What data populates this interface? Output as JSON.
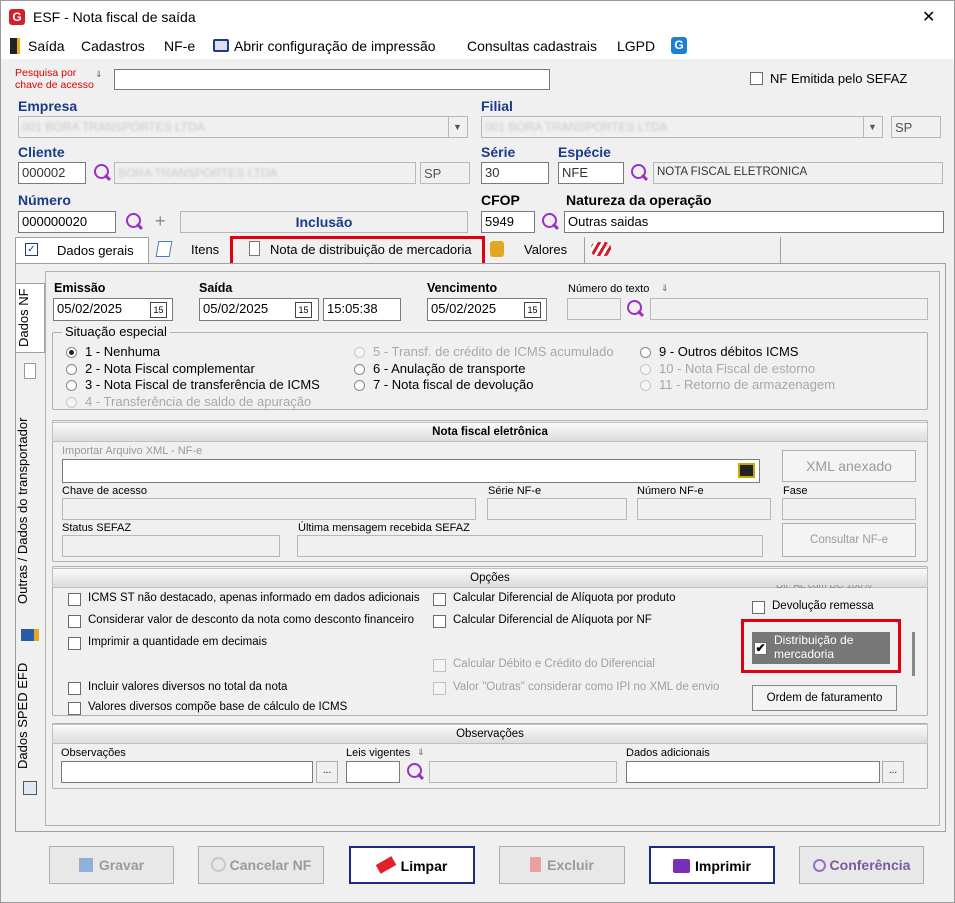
{
  "window": {
    "title": "ESF - Nota fiscal de saída",
    "close": "✕"
  },
  "menu": [
    "Saída",
    "Cadastros",
    "NF-e",
    "Abrir configuração de impressão",
    "Consultas cadastrais",
    "LGPD"
  ],
  "search": {
    "label": "Pesquisa por chave de acesso",
    "value": "",
    "nf_emitida_label": "NF Emitida pelo SEFAZ"
  },
  "empresa": {
    "label": "Empresa",
    "value": "001 BORA TRANSPORTES LTDA"
  },
  "filial": {
    "label": "Filial",
    "value": "001 BORA TRANSPORTES LTDA",
    "uf": "SP"
  },
  "cliente": {
    "label": "Cliente",
    "code": "000002",
    "name": "BORA TRANSPORTES LTDA",
    "uf": "SP"
  },
  "serie": {
    "label": "Série",
    "value": "30"
  },
  "especie": {
    "label": "Espécie",
    "code": "NFE",
    "desc": "NOTA FISCAL ELETRONICA"
  },
  "numero": {
    "label": "Número",
    "value": "000000020",
    "status": "Inclusão"
  },
  "cfop": {
    "label": "CFOP",
    "value": "5949"
  },
  "natureza": {
    "label": "Natureza da operação",
    "value": "Outras saidas"
  },
  "tabs": [
    "Dados gerais",
    "Itens",
    "Nota de distribuição de mercadoria",
    "Valores"
  ],
  "side_tabs": [
    "Dados NF",
    "Outras / Dados do transportador",
    "Dados SPED EFD"
  ],
  "dates": {
    "emissao_label": "Emissão",
    "emissao": "05/02/2025",
    "saida_label": "Saída",
    "saida": "05/02/2025",
    "saida_hora": "15:05:38",
    "venc_label": "Vencimento",
    "venc": "05/02/2025",
    "num_texto_label": "Número do texto",
    "cal_icon": "15"
  },
  "situacao": {
    "title": "Situação especial",
    "options": [
      {
        "text": "1 - Nenhuma",
        "enabled": true,
        "selected": true
      },
      {
        "text": "2 - Nota Fiscal complementar",
        "enabled": true,
        "selected": false
      },
      {
        "text": "3 - Nota Fiscal de transferência de ICMS",
        "enabled": true,
        "selected": false
      },
      {
        "text": "4 - Transferência de saldo de apuração",
        "enabled": false,
        "selected": false
      },
      {
        "text": "5 - Transf. de crédito de ICMS acumulado",
        "enabled": false,
        "selected": false
      },
      {
        "text": "6 - Anulação de transporte",
        "enabled": true,
        "selected": false
      },
      {
        "text": "7 - Nota fiscal de devolução",
        "enabled": true,
        "selected": false
      },
      {
        "text": "9 - Outros débitos ICMS",
        "enabled": true,
        "selected": false
      },
      {
        "text": "10 - Nota Fiscal de estorno",
        "enabled": false,
        "selected": false
      },
      {
        "text": "11 - Retorno de armazenagem",
        "enabled": false,
        "selected": false
      }
    ]
  },
  "nfe": {
    "title": "Nota fiscal eletrônica",
    "import_label": "Importar Arquivo XML - NF-e",
    "xml_btn": "XML anexado",
    "chave_label": "Chave de acesso",
    "serie_label": "Série NF-e",
    "numero_label": "Número NF-e",
    "fase_label": "Fase",
    "status_label": "Status SEFAZ",
    "msg_label": "Última mensagem recebida SEFAZ",
    "consultar_btn": "Consultar NF-e"
  },
  "opcoes": {
    "title": "Opções",
    "items": [
      {
        "text": "ICMS ST não destacado, apenas informado em dados adicionais",
        "enabled": true
      },
      {
        "text": "Considerar valor de desconto da nota como desconto financeiro",
        "enabled": true
      },
      {
        "text": "Imprimir a quantidade em decimais",
        "enabled": true
      },
      {
        "text": "Incluir valores diversos no total da nota",
        "enabled": true
      },
      {
        "text": "Valores diversos compõe base de cálculo de ICMS",
        "enabled": true
      },
      {
        "text": "Calcular Diferencial de Alíquota por produto",
        "enabled": true
      },
      {
        "text": "Calcular Diferencial de Alíquota por NF",
        "enabled": true
      },
      {
        "text": "Calcular Débito e Crédito do Diferencial",
        "enabled": false
      },
      {
        "text": "Valor \"Outras\" considerar como IPI no XML de envio",
        "enabled": false
      },
      {
        "text": "Dif. AL com BC 100%",
        "enabled": true
      },
      {
        "text": "Devolução remessa",
        "enabled": true
      }
    ],
    "distrib": {
      "text": "Distribuição de mercadoria",
      "checked": true
    },
    "ordem_btn": "Ordem de faturamento"
  },
  "obs": {
    "title": "Observações",
    "obs_label": "Observações",
    "leis_label": "Leis vigentes",
    "dados_label": "Dados adicionais",
    "dots": "..."
  },
  "buttons": [
    "Gravar",
    "Cancelar NF",
    "Limpar",
    "Excluir",
    "Imprimir",
    "Conferência"
  ],
  "colors": {
    "accent_red": "#e00010",
    "label_blue": "#1a3a8a",
    "search_purple": "#9b2fc7"
  }
}
